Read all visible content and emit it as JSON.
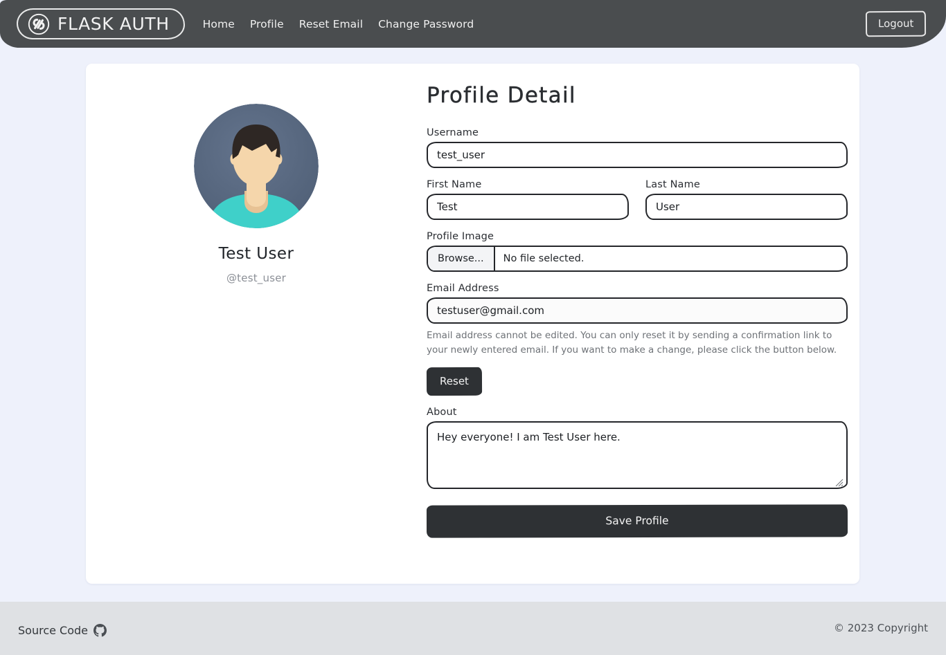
{
  "navbar": {
    "brand_text": "FLASK AUTH",
    "brand_icon": "link-infinity-icon",
    "links": [
      {
        "label": "Home",
        "name": "nav-link-home"
      },
      {
        "label": "Profile",
        "name": "nav-link-profile"
      },
      {
        "label": "Reset Email",
        "name": "nav-link-reset-email"
      },
      {
        "label": "Change Password",
        "name": "nav-link-change-password"
      }
    ],
    "logout_label": "Logout",
    "background_color": "#4a4d4f",
    "text_color": "#f0f0f0"
  },
  "profile_card": {
    "avatar_icon": "default-user-avatar",
    "avatar_colors": {
      "background": "#5b6b82",
      "hair": "#2e2724",
      "skin": "#f5d6ab",
      "skin_shadow": "#e7c294",
      "shirt": "#3fd0c9"
    },
    "display_name": "Test User",
    "handle": "@test_user"
  },
  "form": {
    "title": "Profile Detail",
    "username": {
      "label": "Username",
      "value": "test_user",
      "placeholder": "Username"
    },
    "first_name": {
      "label": "First Name",
      "value": "Test",
      "placeholder": "First Name"
    },
    "last_name": {
      "label": "Last Name",
      "value": "User",
      "placeholder": "Last Name"
    },
    "profile_image": {
      "label": "Profile Image",
      "browse_label": "Browse...",
      "status": "No file selected."
    },
    "email": {
      "label": "Email Address",
      "value": "testuser@gmail.com",
      "placeholder": "Email Address",
      "help": "Email address cannot be edited. You can only reset it by sending a confirmation link to your newly entered email. If you want to make a change, please click the button below.",
      "reset_label": "Reset"
    },
    "about": {
      "label": "About",
      "value": "Hey everyone! I am Test User here.",
      "placeholder": "About"
    },
    "save_label": "Save Profile",
    "button_color": "#2e3134",
    "border_color": "#24262a"
  },
  "footer": {
    "source_code_label": "Source Code",
    "source_code_icon": "github-icon",
    "copyright": "© 2023 Copyright",
    "background_color": "#dfe1e4"
  },
  "page": {
    "background_color": "#eef1fb",
    "card_color": "#ffffff"
  }
}
